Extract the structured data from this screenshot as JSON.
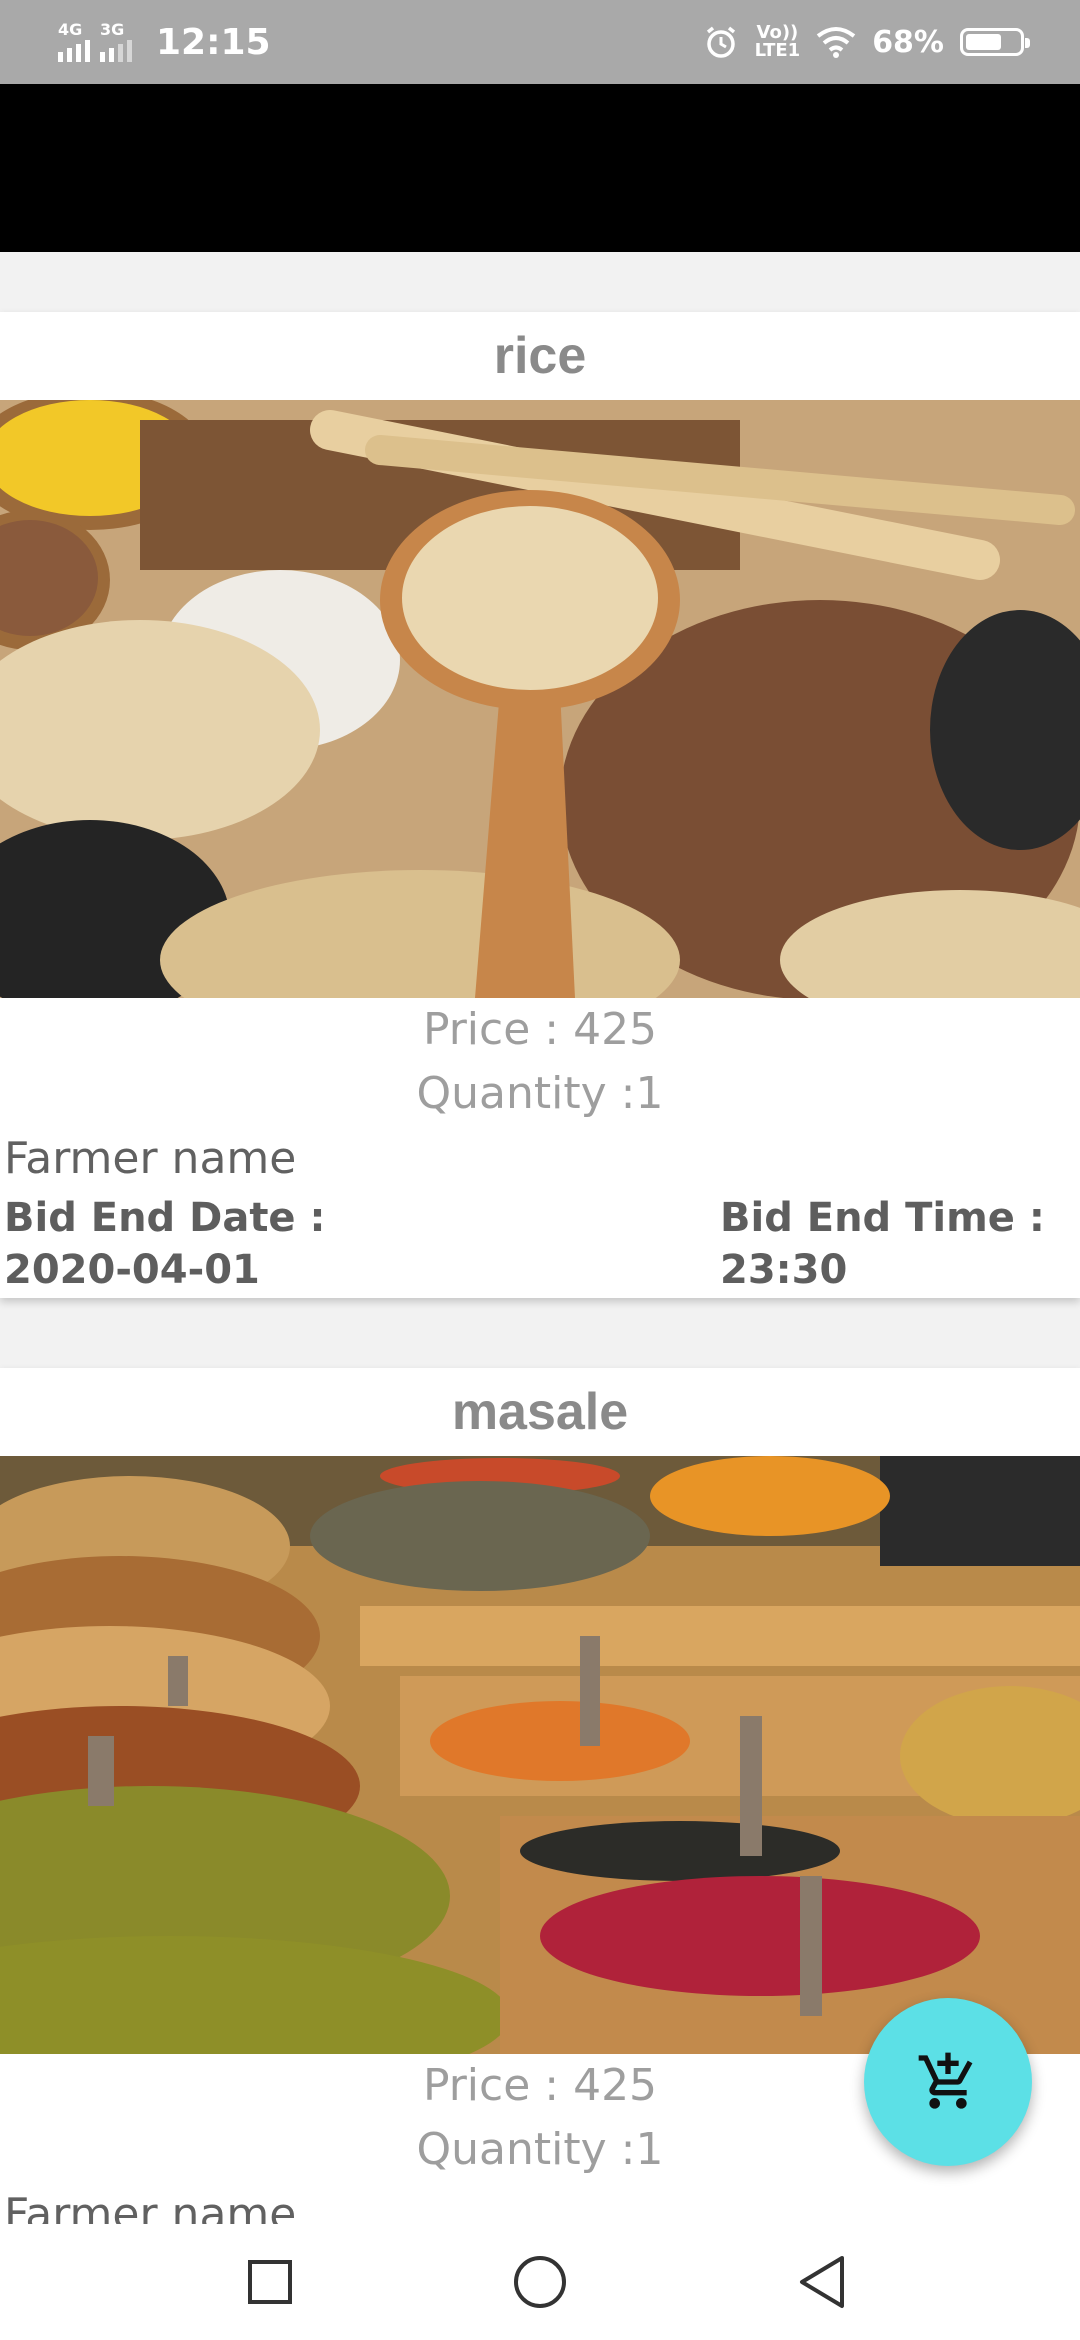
{
  "status_bar": {
    "network_1": "4G",
    "network_2": "3G",
    "time": "12:15",
    "volte_top": "Vo))",
    "volte_bottom": "LTE1",
    "battery": "68%",
    "battery_level": 0.68,
    "icons": [
      "signal-icon",
      "alarm-icon",
      "volte-icon",
      "wifi-icon",
      "battery-icon"
    ]
  },
  "products": [
    {
      "name": "rice",
      "price": "Price : 425",
      "quantity": "Quantity :1",
      "farmer": "Farmer name",
      "bid_date_label": "Bid End Date :",
      "bid_date": "2020-04-01",
      "bid_time_label": "Bid End Time :",
      "bid_time": "23:30",
      "image": "grains-and-seeds-photo"
    },
    {
      "name": "masale",
      "price": "Price : 425",
      "quantity": "Quantity :1",
      "farmer": "Farmer name",
      "image": "spice-market-photo"
    }
  ],
  "fab": {
    "icon": "add-shopping-cart-icon",
    "color": "#5ce0e6"
  },
  "nav_bar": {
    "icons": [
      "recents-square-icon",
      "home-circle-icon",
      "back-triangle-icon"
    ]
  },
  "colors": {
    "status_bar": "#a9a9a9",
    "app_bar": "#000000",
    "background": "#f2f2f2"
  }
}
